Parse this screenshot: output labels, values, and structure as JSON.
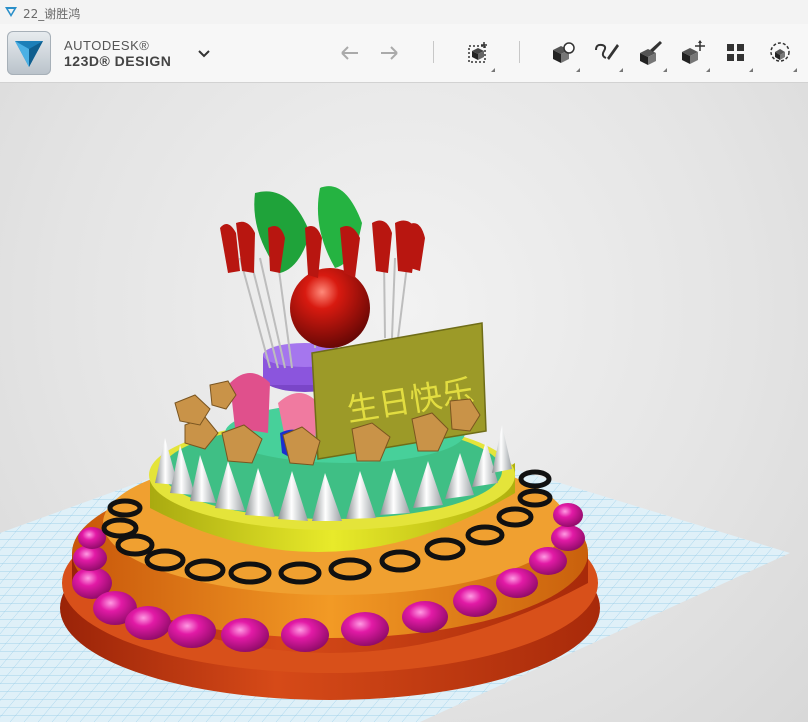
{
  "window": {
    "title": "22_谢胜鸿"
  },
  "brand": {
    "line1": "AUTODESK®",
    "line2": "123D® DESIGN"
  },
  "toolbar": {
    "menu_icon": "chevron-down-icon",
    "tools": [
      {
        "name": "undo",
        "icon": "undo-arrow-icon"
      },
      {
        "name": "redo",
        "icon": "redo-arrow-icon"
      },
      {
        "name": "transform",
        "icon": "transform-box-icon"
      },
      {
        "name": "primitives",
        "icon": "primitive-cube-icon"
      },
      {
        "name": "sketch",
        "icon": "sketch-pencil-icon"
      },
      {
        "name": "construct",
        "icon": "construct-brush-icon"
      },
      {
        "name": "modify",
        "icon": "modify-cube-icon"
      },
      {
        "name": "pattern",
        "icon": "pattern-grid-icon"
      },
      {
        "name": "group",
        "icon": "group-magnifier-icon"
      }
    ]
  },
  "scene": {
    "sign_text": "生日快乐",
    "colors": {
      "base_red": "#c83a10",
      "tier_orange": "#e57b12",
      "tier_yellow": "#d4d616",
      "top_green": "#34b07a",
      "beads": "#e21aa6",
      "sign": "#9c9a28",
      "grid": "#8fc8e6"
    }
  }
}
